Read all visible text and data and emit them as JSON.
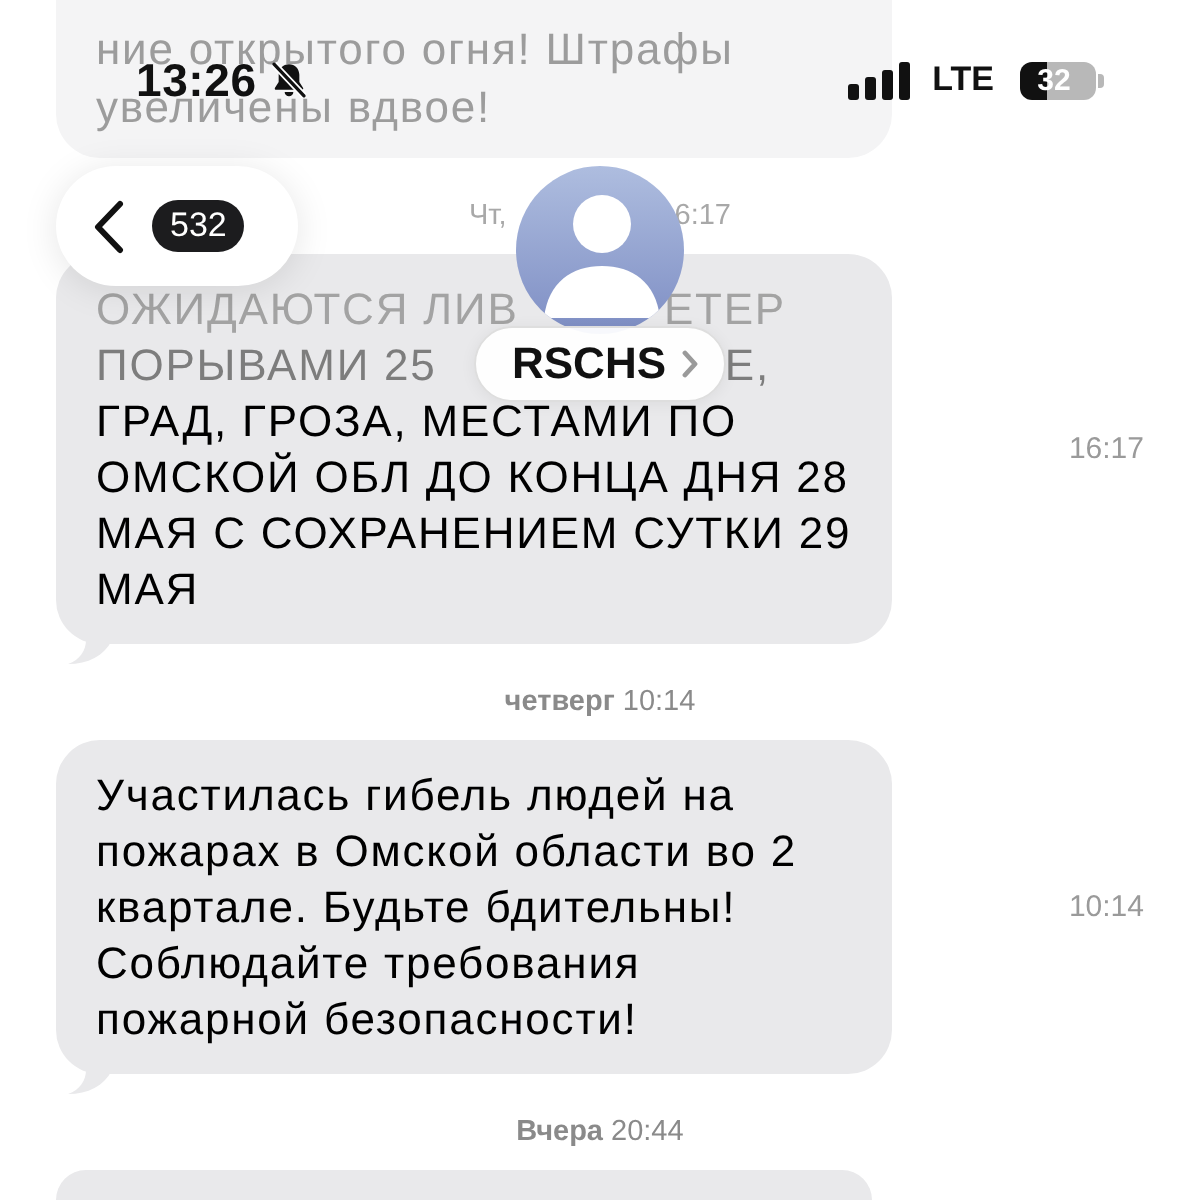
{
  "status_bar": {
    "time": "13:26",
    "silent": true,
    "network": "LTE",
    "battery": "32"
  },
  "nav": {
    "back_count": "532",
    "contact_name": "RSCHS"
  },
  "thread": [
    {
      "kind": "message",
      "faded": true,
      "tail": false,
      "lines": [
        "ние открытого огня! Штрафы",
        "увеличены вдвое!"
      ]
    },
    {
      "kind": "date",
      "faded": true,
      "parts": [
        "Чт,",
        "6:17"
      ]
    },
    {
      "kind": "message",
      "faded": false,
      "tail": true,
      "occluded_lines": [
        {
          "parts": [
            "ОЖИДАЮТСЯ ЛИВ",
            "ЕТЕР"
          ],
          "faded": true
        },
        {
          "parts": [
            "ПОРЫВАМИ 25",
            "Е,"
          ],
          "faded": true
        }
      ],
      "text": "ГРАД, ГРОЗА, МЕСТАМИ ПО ОМСКОЙ ОБЛ ДО КОНЦА ДНЯ 28 МАЯ С СОХРАНЕНИЕМ СУТКИ 29 МАЯ",
      "time": "16:17"
    },
    {
      "kind": "date",
      "faded": false,
      "parts": [
        "**четверг** 10:14"
      ]
    },
    {
      "kind": "message",
      "faded": false,
      "tail": true,
      "text": "Участилась гибель людей на пожарах в Омской области во 2 квартале. Будьте бдительны! Соблюдайте требования пожарной безопасности!",
      "time": "10:14"
    },
    {
      "kind": "date",
      "faded": false,
      "parts": [
        "**Вчера** 20:44"
      ]
    },
    {
      "kind": "message"
    }
  ]
}
